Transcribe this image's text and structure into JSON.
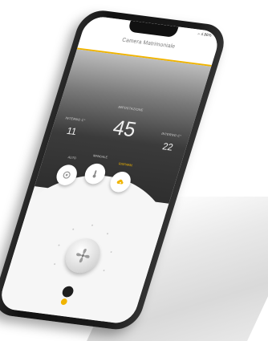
{
  "app": {
    "title": "Camera Matrimoniale",
    "status": "⌐ ıl 86%"
  },
  "temperatures": {
    "left": {
      "label": "INTERNO  C°",
      "value": "11"
    },
    "center": {
      "label": "IMPOSTAZIONE",
      "value": "45"
    },
    "right": {
      "label": "INTERNO C°",
      "value": "22"
    }
  },
  "modes": [
    {
      "label": "AUTO",
      "icon": "auto-icon",
      "active": false
    },
    {
      "label": "MANUALE",
      "icon": "thermometer-icon",
      "active": false
    },
    {
      "label": "RISPARM.",
      "icon": "eco-cloud-icon",
      "active": true
    }
  ],
  "colors": {
    "accent": "#f0b400",
    "dark": "#2e2e2e",
    "panel": "#f6f6f6"
  },
  "fan": {
    "icon": "fan-icon"
  }
}
